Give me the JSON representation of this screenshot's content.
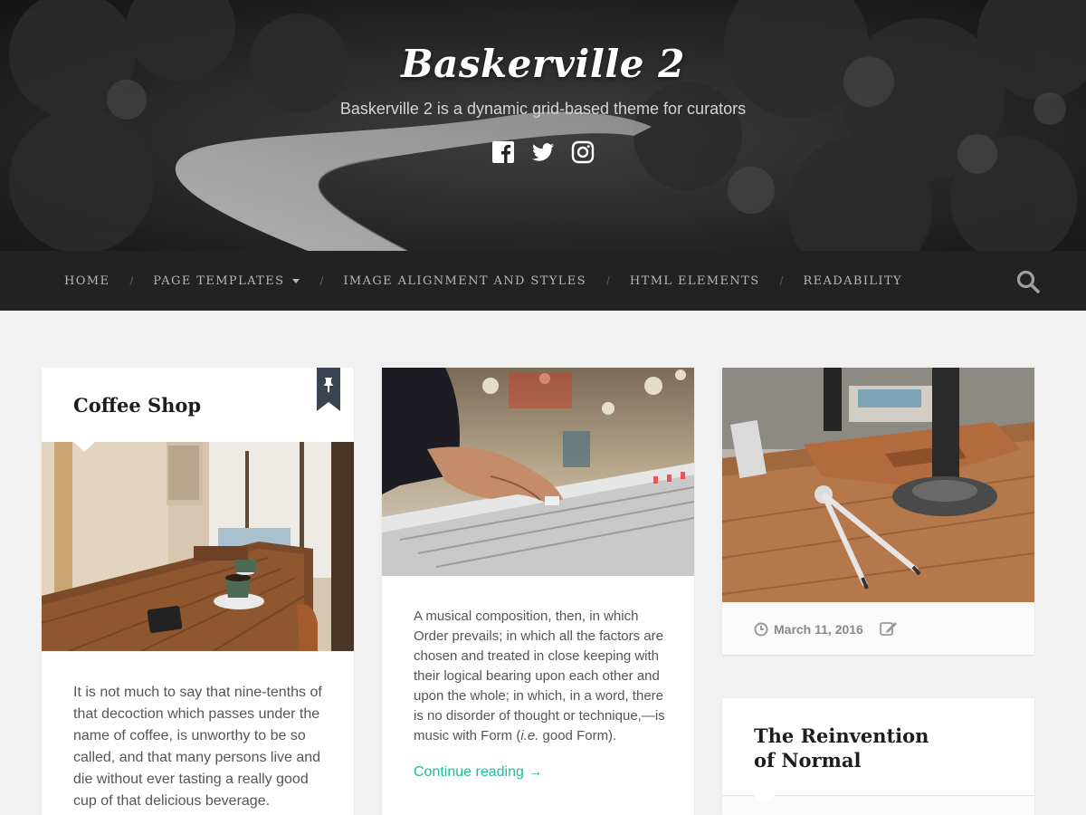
{
  "site": {
    "title": "Baskerville 2",
    "description": "Baskerville 2 is a dynamic grid-based theme for curators",
    "social": [
      "facebook-icon",
      "twitter-icon",
      "instagram-icon"
    ]
  },
  "nav": {
    "items": [
      {
        "label": "Home"
      },
      {
        "label": "Page Templates",
        "has_dropdown": true
      },
      {
        "label": "Image Alignment and Styles"
      },
      {
        "label": "HTML Elements"
      },
      {
        "label": "Readability"
      }
    ],
    "search_icon": "search-icon"
  },
  "colors": {
    "accent": "#1abc9c",
    "nav_bg": "#222222",
    "page_bg": "#f1f1f1",
    "sticky_flag": "#3a4552"
  },
  "posts": [
    {
      "title": "Coffee Shop",
      "sticky": true,
      "image": "cafe-table-with-coffee-cup-photo",
      "excerpt": "It is not much to say that nine-tenths of that decoction which passes under the name of coffee, is unworthy to be so called, and that many persons live and die without ever tasting a really good cup of that delicious beverage."
    },
    {
      "image": "hand-on-mixing-console-photo",
      "excerpt_before": "A musical composition, then, in which Order prevails; in which all the factors are chosen and treated in close keeping with their logical bearing upon each other and upon the whole; in which, in a word, there is no disorder of thought or technique,—is music with Form (",
      "excerpt_italic": "i.e.",
      "excerpt_after": " good Form).",
      "continue_label": "Continue reading →"
    },
    {
      "image": "compass-and-leather-notebook-on-desk-photo",
      "date": "March 11, 2016",
      "meta_icons": [
        "clock-icon",
        "edit-icon"
      ]
    },
    {
      "title": "The Reinvention of Normal"
    }
  ]
}
